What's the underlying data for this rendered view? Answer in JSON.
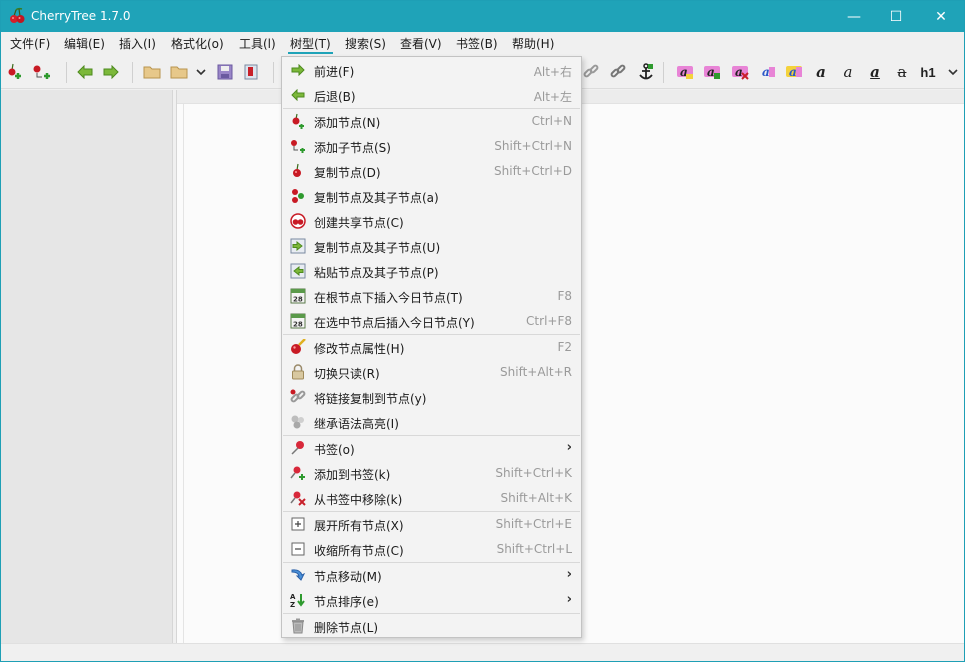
{
  "window": {
    "title": "CherryTree 1.7.0",
    "accent_color": "#1fa3b8"
  },
  "titlebar": {
    "minimize_glyph": "—",
    "maximize_glyph": "☐",
    "close_glyph": "✕"
  },
  "menubar": {
    "items": [
      {
        "label": "文件(F)"
      },
      {
        "label": "编辑(E)"
      },
      {
        "label": "插入(I)"
      },
      {
        "label": "格式化(o)"
      },
      {
        "label": "工具(l)"
      },
      {
        "label": "树型(T)",
        "active": true
      },
      {
        "label": "搜索(S)"
      },
      {
        "label": "查看(V)"
      },
      {
        "label": "书签(B)"
      },
      {
        "label": "帮助(H)"
      }
    ]
  },
  "toolbar": {
    "icons_left": [
      "add-node-icon",
      "add-subnode-icon",
      "go-back-icon",
      "go-forward-icon",
      "open-folder-icon",
      "open-folder-dropdown-icon",
      "save-icon",
      "export-icon"
    ],
    "icons_right": [
      "link-icon",
      "link-alt-icon",
      "anchor-icon",
      "highlight-a-1-icon",
      "highlight-a-2-icon",
      "highlight-a-3-icon",
      "highlight-a-4-icon",
      "highlight-a-5-icon",
      "bold-a-icon",
      "italic-a-icon",
      "underline-a-icon",
      "strikethrough-a-icon",
      "heading-icon"
    ],
    "heading_label": "h1",
    "dropdown_glyph": "⌄"
  },
  "tree_menu": {
    "items": [
      {
        "label": "前进(F)",
        "accel": "Alt+右",
        "icon": "forward-arrow-icon"
      },
      {
        "label": "后退(B)",
        "accel": "Alt+左",
        "icon": "back-arrow-icon"
      },
      {
        "label": "添加节点(N)",
        "accel": "Ctrl+N",
        "icon": "add-node-icon"
      },
      {
        "label": "添加子节点(S)",
        "accel": "Shift+Ctrl+N",
        "icon": "add-subnode-icon"
      },
      {
        "label": "复制节点(D)",
        "accel": "Shift+Ctrl+D",
        "icon": "duplicate-node-icon"
      },
      {
        "label": "复制节点及其子节点(a)",
        "accel": "",
        "icon": "duplicate-tree-icon"
      },
      {
        "label": "创建共享节点(C)",
        "accel": "",
        "icon": "shared-node-icon"
      },
      {
        "label": "复制节点及其子节点(U)",
        "accel": "",
        "icon": "copy-tree-icon"
      },
      {
        "label": "粘贴节点及其子节点(P)",
        "accel": "",
        "icon": "paste-tree-icon"
      },
      {
        "label": "在根节点下插入今日节点(T)",
        "accel": "F8",
        "icon": "calendar-icon"
      },
      {
        "label": "在选中节点后插入今日节点(Y)",
        "accel": "Ctrl+F8",
        "icon": "calendar-icon"
      },
      {
        "label": "修改节点属性(H)",
        "accel": "F2",
        "icon": "edit-node-icon"
      },
      {
        "label": "切换只读(R)",
        "accel": "Shift+Alt+R",
        "icon": "lock-icon"
      },
      {
        "label": "将链接复制到节点(y)",
        "accel": "",
        "icon": "link-icon"
      },
      {
        "label": "继承语法高亮(I)",
        "accel": "",
        "icon": "inherit-syntax-icon"
      },
      {
        "label": "书签(o)",
        "accel": "",
        "icon": "pushpin-icon",
        "submenu": true
      },
      {
        "label": "添加到书签(k)",
        "accel": "Shift+Ctrl+K",
        "icon": "pushpin-add-icon"
      },
      {
        "label": "从书签中移除(k)",
        "accel": "Shift+Alt+K",
        "icon": "pushpin-remove-icon"
      },
      {
        "label": "展开所有节点(X)",
        "accel": "Shift+Ctrl+E",
        "icon": "expand-all-icon"
      },
      {
        "label": "收缩所有节点(C)",
        "accel": "Shift+Ctrl+L",
        "icon": "collapse-all-icon"
      },
      {
        "label": "节点移动(M)",
        "accel": "",
        "icon": "move-node-icon",
        "submenu": true
      },
      {
        "label": "节点排序(e)",
        "accel": "",
        "icon": "sort-nodes-icon",
        "submenu": true
      },
      {
        "label": "删除节点(L)",
        "accel": "",
        "icon": "trash-icon"
      }
    ],
    "submenu_glyph": "›"
  }
}
